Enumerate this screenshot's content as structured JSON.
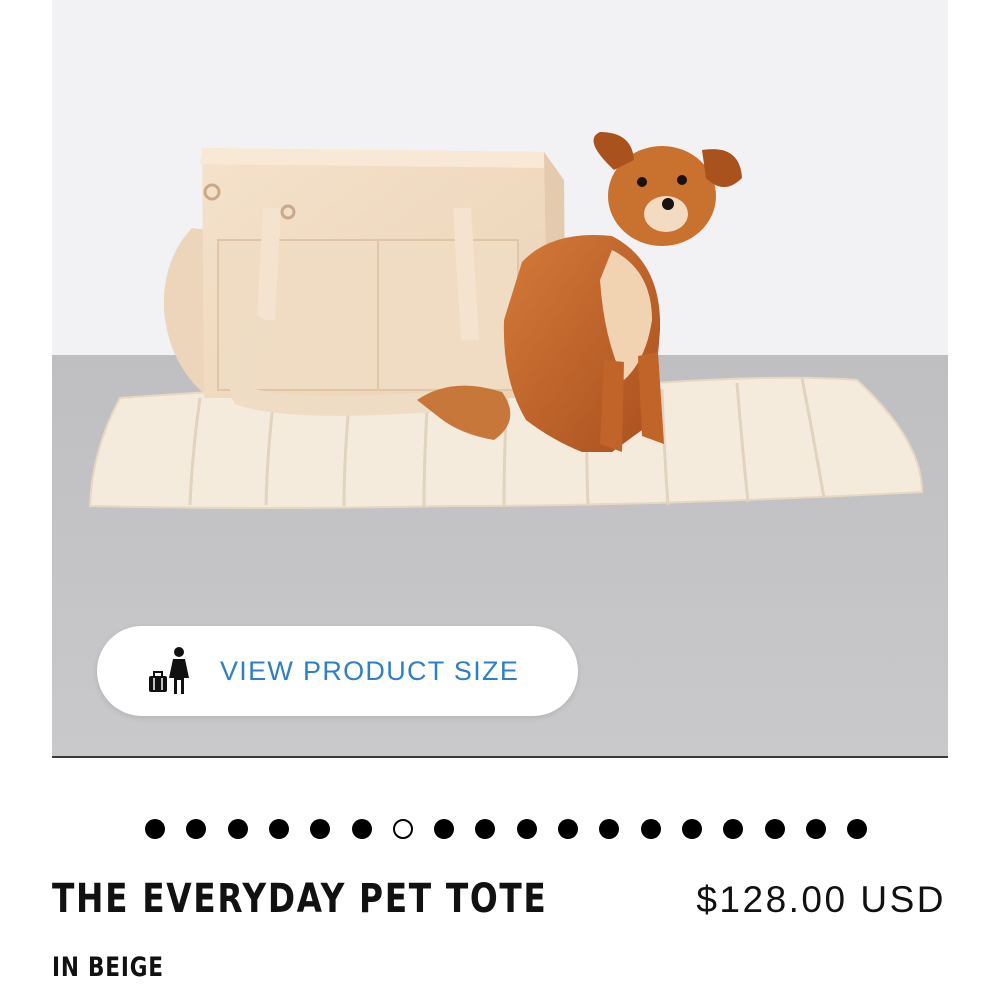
{
  "product_image": {
    "alt_icon": "product-photo",
    "size_button": {
      "label": "VIEW PRODUCT SIZE",
      "icon": "person-with-luggage-icon"
    }
  },
  "carousel": {
    "total": 18,
    "active_index": 6
  },
  "product": {
    "title": "THE EVERYDAY PET TOTE",
    "price": "$128.00 USD",
    "variant": "IN BEIGE"
  },
  "colors": {
    "link_blue": "#2f7fc4",
    "text": "#111111",
    "tote_beige": "#f1dcc4",
    "dog_orange": "#c2652a"
  }
}
